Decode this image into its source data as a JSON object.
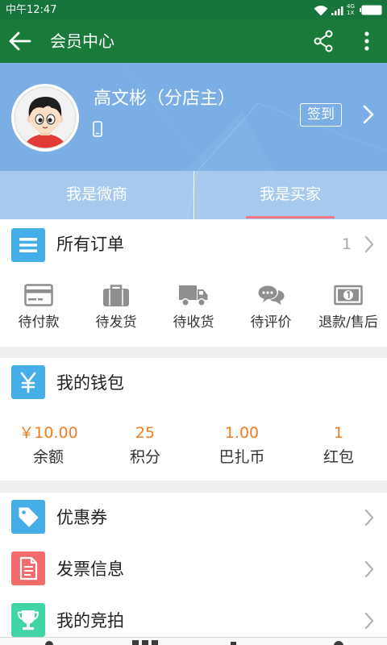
{
  "status_bar": {
    "time": "中午12:47",
    "network_top": "4G",
    "network_bottom": "1X"
  },
  "header": {
    "title": "会员中心",
    "back_icon": "back-arrow-icon",
    "share_icon": "share-icon",
    "more_icon": "more-vertical-icon"
  },
  "profile": {
    "name": "高文彬（分店主）",
    "checkin_label": "签到",
    "phone_icon": "phone-icon"
  },
  "tabs": [
    {
      "label": "我是微商",
      "active": false
    },
    {
      "label": "我是买家",
      "active": true
    }
  ],
  "orders": {
    "title": "所有订单",
    "count": "1",
    "icon": "list-icon",
    "statuses": [
      {
        "label": "待付款",
        "icon": "card-icon"
      },
      {
        "label": "待发货",
        "icon": "briefcase-icon"
      },
      {
        "label": "待收货",
        "icon": "truck-icon"
      },
      {
        "label": "待评价",
        "icon": "chat-bubbles-icon"
      },
      {
        "label": "退款/售后",
        "icon": "banknote-icon"
      }
    ]
  },
  "wallet": {
    "title": "我的钱包",
    "icon": "yen-icon",
    "items": [
      {
        "value": "￥10.00",
        "label": "余额"
      },
      {
        "value": "25",
        "label": "积分"
      },
      {
        "value": "1.00",
        "label": "巴扎币"
      },
      {
        "value": "1",
        "label": "红包"
      }
    ]
  },
  "menu": [
    {
      "label": "优惠券",
      "icon": "coupon-tag-icon",
      "color": "#45aee8"
    },
    {
      "label": "发票信息",
      "icon": "invoice-document-icon",
      "color": "#f26c6c"
    },
    {
      "label": "我的竞拍",
      "icon": "trophy-icon",
      "color": "#41d4a6"
    }
  ],
  "colors": {
    "status_bar": "#17743a",
    "header": "#1a7a3a",
    "profile": "#7aaee5",
    "tabs": "#a7c9ee",
    "active_tab_underline": "#f07d86",
    "accent_blue": "#45aee8",
    "wallet_value": "#f27c1e",
    "status_icon": "#8e8e8e"
  }
}
